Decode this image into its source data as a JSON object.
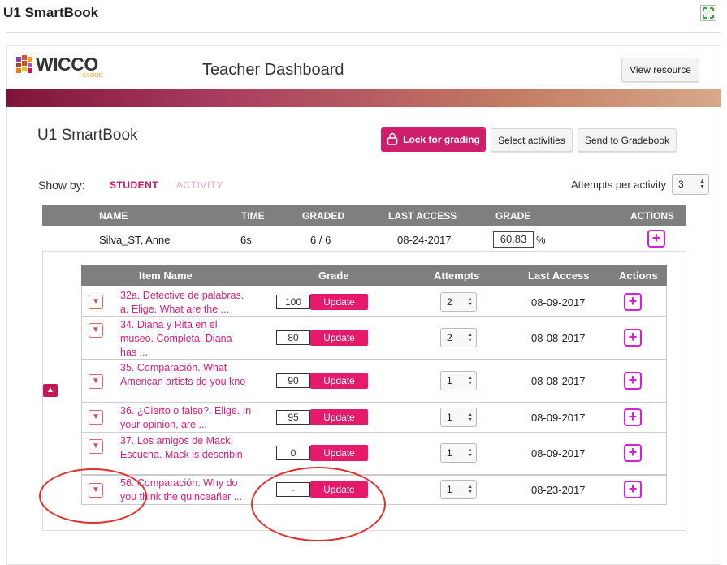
{
  "page": {
    "title": "U1 SmartBook"
  },
  "header": {
    "logo_text": "WICCO",
    "logo_sub": "CLOUD",
    "dashboard_title": "Teacher Dashboard",
    "view_resource": "View resource"
  },
  "smartbook": {
    "title": "U1 SmartBook",
    "lock_label": "Lock for grading",
    "select_label": "Select activities",
    "send_label": "Send to Gradebook"
  },
  "show_by": {
    "label": "Show by:",
    "student": "STUDENT",
    "activity": "ACTIVITY"
  },
  "attempts": {
    "label": "Attempts per activity",
    "value": "3"
  },
  "main_table": {
    "headers": {
      "name": "NAME",
      "time": "TIME",
      "graded": "GRADED",
      "last_access": "LAST ACCESS",
      "grade": "GRADE",
      "actions": "ACTIONS"
    },
    "student": {
      "name": "Silva_ST, Anne",
      "time": "6s",
      "graded": "6 / 6",
      "last_access": "08-24-2017",
      "grade": "60.83",
      "pct": "%"
    }
  },
  "detail": {
    "headers": {
      "item_name": "Item Name",
      "grade": "Grade",
      "attempts": "Attempts",
      "last_access": "Last Access",
      "actions": "Actions"
    },
    "update_label": "Update",
    "rows": [
      {
        "line1": "32a. Detective de palabras.",
        "line2": "a. Elige. What are the ...",
        "grade": "100",
        "attempts": "2",
        "last_access": "08-09-2017"
      },
      {
        "line1": "34. Diana y Rita en el",
        "line2": "museo. Completa. Diana",
        "line3": "has ...",
        "grade": "80",
        "attempts": "2",
        "last_access": "08-08-2017"
      },
      {
        "line1": "35. Comparación. What",
        "line2": "American artists do you kno",
        "grade": "90",
        "attempts": "1",
        "last_access": "08-08-2017"
      },
      {
        "line1": "36. ¿Cierto o falso?. Elige. In",
        "line2": "your opinion, are ...",
        "grade": "95",
        "attempts": "1",
        "last_access": "08-09-2017"
      },
      {
        "line1": "37. Los amigos de Mack.",
        "line2": "Escucha. Mack is describin",
        "grade": "0",
        "attempts": "1",
        "last_access": "08-09-2017"
      },
      {
        "line1": "56. Comparación. Why do",
        "line2": "you think the quinceañer ...",
        "grade": "-",
        "attempts": "1",
        "last_access": "08-23-2017"
      }
    ]
  },
  "colors": {
    "accent": "#cf1e6a",
    "link": "#d61f7a",
    "header_gray": "#7f7f7f",
    "annotation": "#e0302c"
  },
  "icons": {
    "add_comment": "plus-square-icon",
    "expand": "expand-icon",
    "lock": "lock-icon"
  }
}
